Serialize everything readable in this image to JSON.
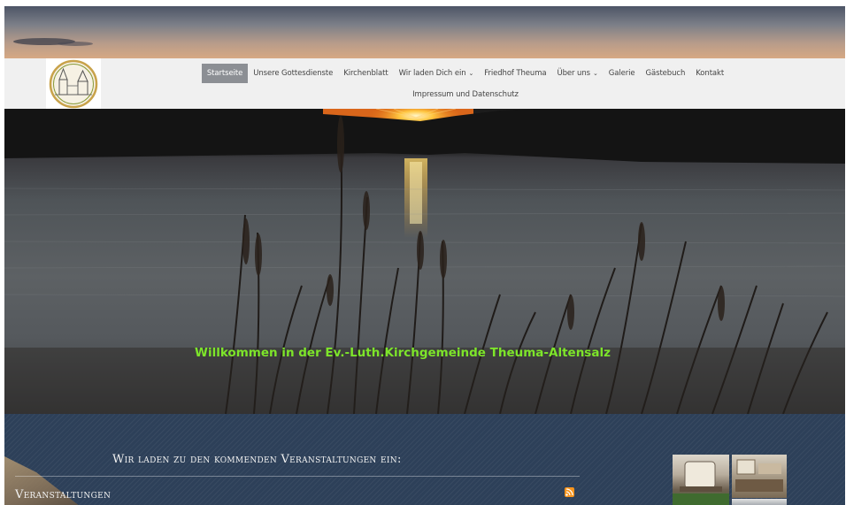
{
  "nav": {
    "logo_alt": "Kirchgemeinde Logo",
    "items": [
      {
        "label": "Startseite",
        "active": true,
        "dropdown": false
      },
      {
        "label": "Unsere Gottesdienste",
        "active": false,
        "dropdown": false
      },
      {
        "label": "Kirchenblatt",
        "active": false,
        "dropdown": false
      },
      {
        "label": "Wir laden Dich ein",
        "active": false,
        "dropdown": true
      },
      {
        "label": "Friedhof Theuma",
        "active": false,
        "dropdown": false
      },
      {
        "label": "Über uns",
        "active": false,
        "dropdown": true
      },
      {
        "label": "Galerie",
        "active": false,
        "dropdown": false
      },
      {
        "label": "Gästebuch",
        "active": false,
        "dropdown": false
      },
      {
        "label": "Kontakt",
        "active": false,
        "dropdown": false
      }
    ],
    "second_row": [
      {
        "label": "Impressum und Datenschutz"
      }
    ],
    "active_bg": "#8c8f94"
  },
  "hero": {
    "welcome_text": "Willkommen in der Ev.-Luth.Kirchgemeinde Theuma-Altensalz",
    "welcome_color": "#7de52a"
  },
  "section": {
    "invite_heading": "Wir laden zu den kommenden Veranstaltungen ein:",
    "events_heading": "Veranstaltungen",
    "rss_icon": "rss-icon",
    "background": "#2d4059"
  }
}
